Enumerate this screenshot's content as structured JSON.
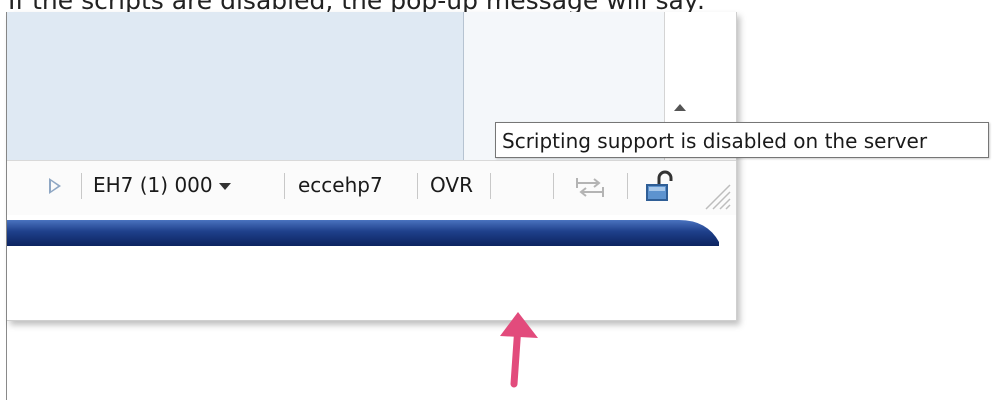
{
  "caption": "If the scripts are disabled, the pop-up message will say:",
  "tooltip": {
    "text": "Scripting support is disabled on the server"
  },
  "status_bar": {
    "system": "EH7 (1) 000",
    "server": "eccehp7",
    "mode": "OVR"
  },
  "icons": {
    "status_play": "play-triangle-icon",
    "system_dropdown": "chevron-down-icon",
    "scroll_up": "scroll-up-arrow-icon",
    "connection": "swap-arrows-icon",
    "security": "open-padlock-icon",
    "resize": "resize-grip-icon",
    "annotation": "pointer-arrow-icon"
  },
  "colors": {
    "content_bg": "#dfe9f3",
    "status_bar_bg": "#fbfbfb",
    "band_blue": "#1e3f8a",
    "lock_blue": "#3f76b7",
    "annotation_pink": "#e24b7c"
  }
}
